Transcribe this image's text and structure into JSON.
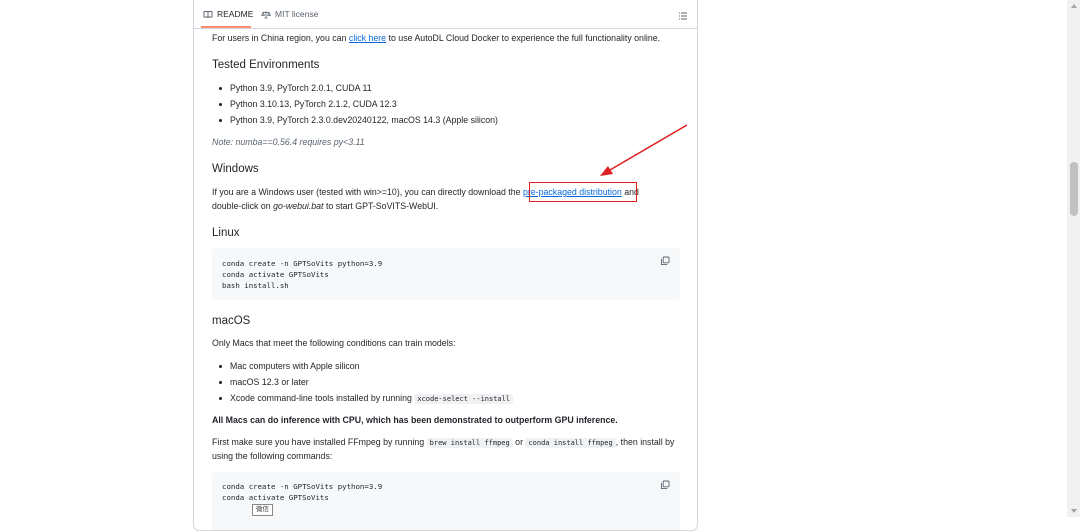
{
  "tabs": {
    "readme": "README",
    "license": "MIT license"
  },
  "china_note": {
    "before": "For users in China region, you can ",
    "link": "click here",
    "after": " to use AutoDL Cloud Docker to experience the full functionality online."
  },
  "tested": {
    "heading": "Tested Environments",
    "items": [
      "Python 3.9, PyTorch 2.0.1, CUDA 11",
      "Python 3.10.13, PyTorch 2.1.2, CUDA 12.3",
      "Python 3.9, PyTorch 2.3.0.dev20240122, macOS 14.3 (Apple silicon)"
    ],
    "note": "Note: numba==0.56.4 requires py<3.11"
  },
  "windows": {
    "heading": "Windows",
    "line1_before": "If you are a Windows user (tested with win>=10), you can directly download the ",
    "link": "pre-packaged distribution",
    "line1_after": " and",
    "line2_before": "double-click on ",
    "line2_em": "go-webui.bat",
    "line2_after": " to start GPT-SoVITS-WebUI."
  },
  "linux": {
    "heading": "Linux",
    "code": [
      "conda create -n GPTSoVits python=3.9",
      "conda activate GPTSoVits",
      "bash install.sh"
    ]
  },
  "macos": {
    "heading": "macOS",
    "intro": "Only Macs that meet the following conditions can train models:",
    "items": [
      "Mac computers with Apple silicon",
      "macOS 12.3 or later"
    ],
    "xcode_text": "Xcode command-line tools installed by running ",
    "xcode_code": "xcode-select --install",
    "bold_line": "All Macs can do inference with CPU, which has been demonstrated to outperform GPU inference.",
    "ffmpeg_1": "First make sure you have installed FFmpeg by running ",
    "ffmpeg_code1": "brew install ffmpeg",
    "ffmpeg_or": " or ",
    "ffmpeg_code2": "conda install ffmpeg",
    "ffmpeg_2": ", then install by",
    "ffmpeg_3": "using the following commands:",
    "code": [
      "conda create -n GPTSoVits python=3.9",
      "conda activate GPTSoVits"
    ]
  },
  "tooltip": "微信",
  "colors": {
    "link": "#0969da",
    "annotation": "#e02020",
    "tab_underline": "#fd8c73"
  }
}
